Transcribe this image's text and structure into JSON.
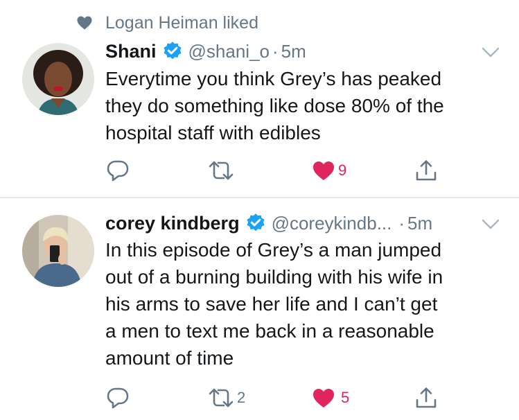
{
  "colors": {
    "secondary": "#657786",
    "like": "#e0245e",
    "verified": "#1da1f2",
    "divider": "#e1e8ed"
  },
  "social_context": {
    "icon": "heart-icon",
    "text": "Logan Heiman liked"
  },
  "tweets": [
    {
      "display_name": "Shani",
      "verified": true,
      "handle": "@shani_o",
      "separator": "·",
      "time": "5m",
      "text": "Everytime you think Grey’s has peaked\nthey do something like dose 80% of the\nhospital staff with edibles",
      "actions": {
        "reply_count": "",
        "retweet_count": "",
        "like_count": "9",
        "liked": true
      }
    },
    {
      "display_name": "corey kindberg",
      "verified": true,
      "handle": "@coreykindb...",
      "separator": "·",
      "time": "5m",
      "text": "In this episode of Grey’s a man jumped\nout of a burning building with his wife in\nhis arms to save her life and I can’t get\na men to text me back in a reasonable\namount of time",
      "actions": {
        "reply_count": "",
        "retweet_count": "2",
        "like_count": "5",
        "liked": true
      }
    }
  ]
}
